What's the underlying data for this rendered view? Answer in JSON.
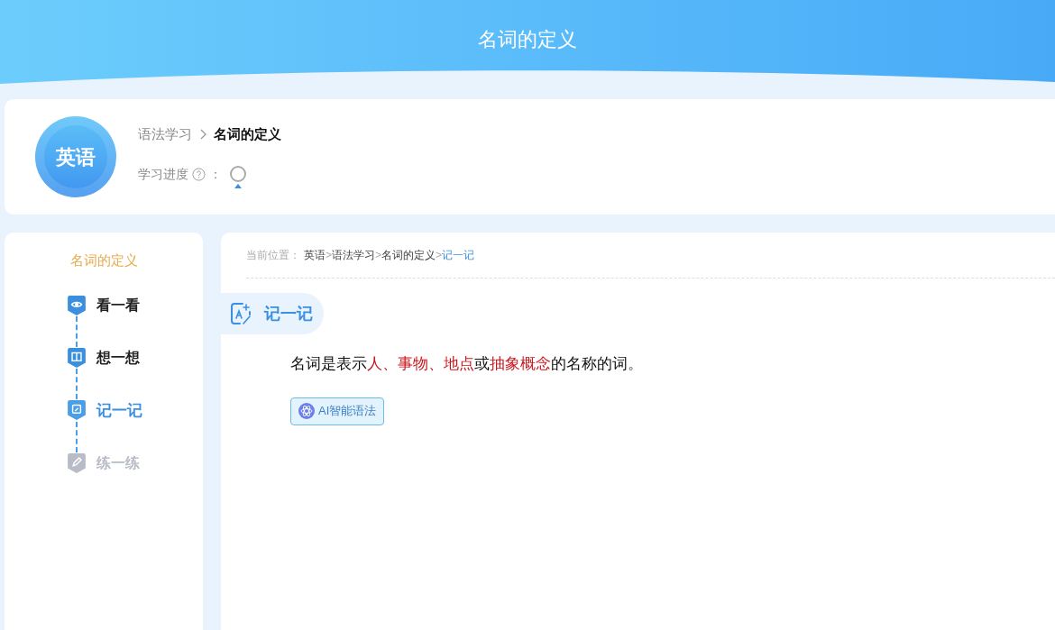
{
  "header": {
    "title": "名词的定义"
  },
  "subject": {
    "badge": "英语",
    "crumbs": [
      {
        "label": "语法学习",
        "selected": false
      },
      {
        "label": "名词的定义",
        "selected": true
      }
    ],
    "progress_label": "学习进度",
    "progress_colon": "："
  },
  "sidebar": {
    "title": "名词的定义",
    "steps": [
      {
        "label": "看一看",
        "selected": false,
        "disabled": false
      },
      {
        "label": "想一想",
        "selected": false,
        "disabled": false
      },
      {
        "label": "记一记",
        "selected": true,
        "disabled": false
      },
      {
        "label": "练一练",
        "selected": false,
        "disabled": true
      }
    ]
  },
  "location": {
    "label": "当前位置：",
    "separator": ">",
    "items": [
      {
        "label": "英语",
        "selected": false
      },
      {
        "label": "语法学习",
        "selected": false
      },
      {
        "label": "名词的定义",
        "selected": false
      },
      {
        "label": "记一记",
        "selected": true
      }
    ]
  },
  "section": {
    "title": "记一记",
    "sentence": [
      {
        "text": "名词是表示",
        "highlight": false
      },
      {
        "text": "人、事物、地点",
        "highlight": true
      },
      {
        "text": "或",
        "highlight": false
      },
      {
        "text": "抽象概念",
        "highlight": true
      },
      {
        "text": "的名称的词。",
        "highlight": false
      }
    ],
    "ai_button": "AI智能语法"
  }
}
